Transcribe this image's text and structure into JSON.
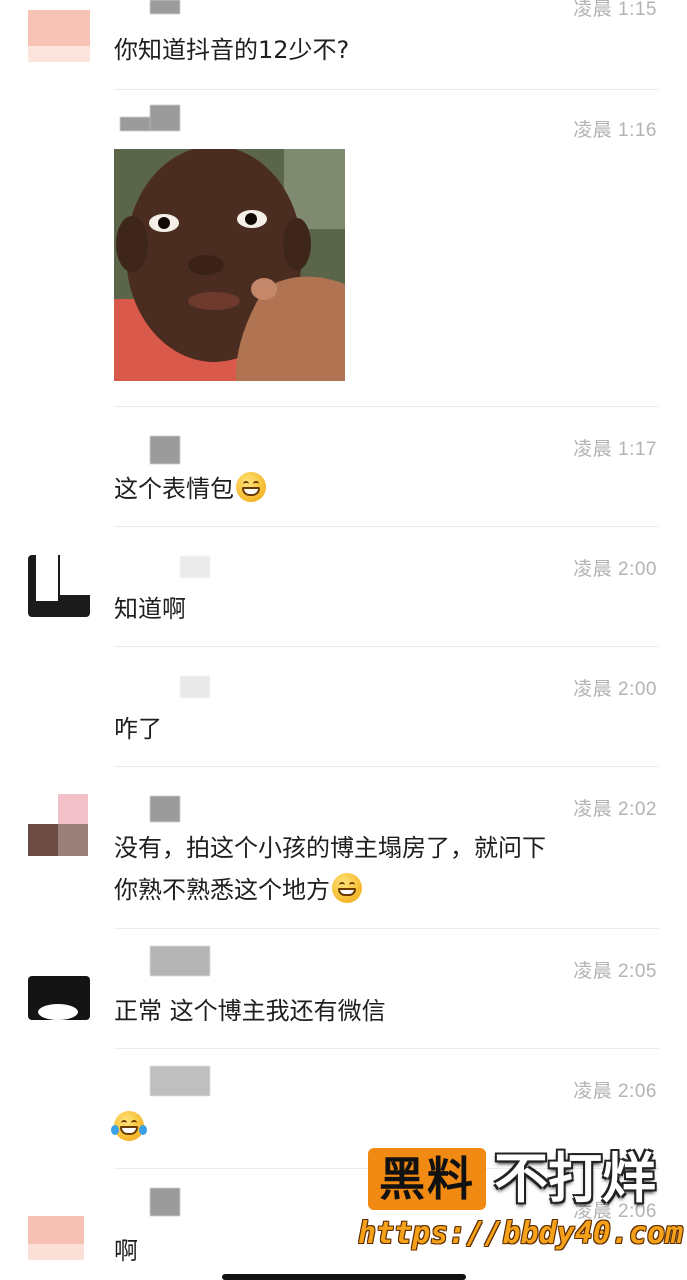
{
  "messages": [
    {
      "time": "凌晨 1:15",
      "text": "你知道抖音的12少不?"
    },
    {
      "time": "凌晨 1:16",
      "text": ""
    },
    {
      "time": "凌晨 1:17",
      "text": "这个表情包",
      "emoji": "grinning-face-icon"
    },
    {
      "time": "凌晨 2:00",
      "text": "知道啊"
    },
    {
      "time": "凌晨 2:00",
      "text": "咋了"
    },
    {
      "time": "凌晨 2:02",
      "text_line1": "没有，拍这个小孩的博主塌房了，就问下",
      "text_line2": "你熟不熟悉这个地方",
      "emoji": "grinning-face-icon"
    },
    {
      "time": "凌晨 2:05",
      "text": "正常 这个博主我还有微信"
    },
    {
      "time": "凌晨 2:06",
      "text": "",
      "emoji": "tears-of-joy-icon"
    },
    {
      "time": "凌晨 2:06",
      "text": "啊"
    }
  ],
  "watermark": {
    "box_text": "黑料",
    "text": "不打烊",
    "url": "https://bbdy40.com"
  },
  "colors": {
    "accent": "#f08a12",
    "time_text": "#b3b3b3",
    "divider": "#ececec"
  }
}
